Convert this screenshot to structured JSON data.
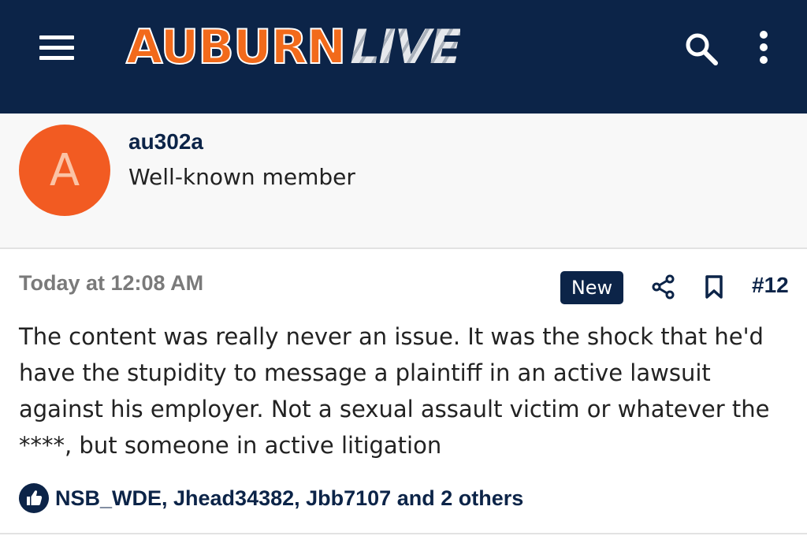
{
  "header": {
    "logo_primary": "AUBURN",
    "logo_secondary": "LIVE",
    "menu_icon": "hamburger-menu-icon",
    "search_icon": "search-icon",
    "more_icon": "vertical-ellipsis-icon",
    "background_color": "#0c2448",
    "logo_primary_color": "#f26a1b"
  },
  "member": {
    "avatar_letter": "A",
    "avatar_color": "#f25b22",
    "username": "au302a",
    "title": "Well-known member"
  },
  "post": {
    "timestamp": "Today at 12:08 AM",
    "new_badge": "New",
    "share_icon": "share-icon",
    "bookmark_icon": "bookmark-icon",
    "number": "#12",
    "body": "The content was really never an issue. It was the shock that he'd have the stupidity to message a plaintiff in an active lawsuit against his employer. Not a sexual assault victim or whatever the ****, but someone in active litigation",
    "reactions": {
      "icon": "thumbs-up-icon",
      "text": "NSB_WDE, Jhead34382, Jbb7107 and 2 others"
    }
  }
}
